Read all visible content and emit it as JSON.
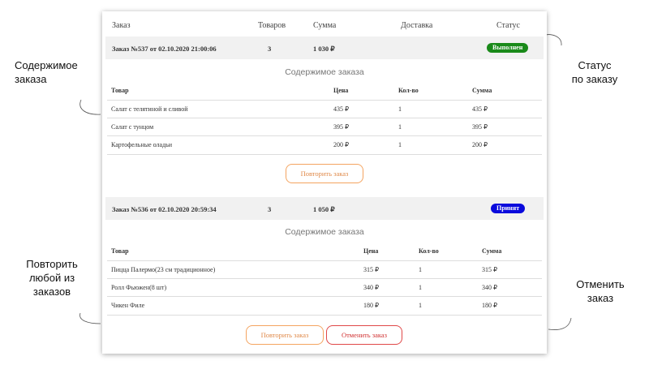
{
  "table_header": {
    "order": "Заказ",
    "items": "Товаров",
    "sum": "Сумма",
    "delivery": "Доставка",
    "status": "Статус"
  },
  "orders": [
    {
      "title": "Заказ №537 от 02.10.2020 21:00:06",
      "items_count": "3",
      "sum": "1 030 ₽",
      "status": "Выполнен",
      "status_color": "#1a8a1a",
      "contents_title": "Содержимое заказа",
      "columns": {
        "product": "Товар",
        "price": "Цена",
        "qty": "Кол-во",
        "sum": "Сумма"
      },
      "rows": [
        {
          "product": "Салат с телятиной и сливой",
          "price": "435 ₽",
          "qty": "1",
          "sum": "435 ₽"
        },
        {
          "product": "Салат с тунцом",
          "price": "395 ₽",
          "qty": "1",
          "sum": "395 ₽"
        },
        {
          "product": "Картофельные оладьи",
          "price": "200 ₽",
          "qty": "1",
          "sum": "200 ₽"
        }
      ],
      "repeat_label": "Повторить заказ"
    },
    {
      "title": "Заказ №536 от 02.10.2020 20:59:34",
      "items_count": "3",
      "sum": "1 050 ₽",
      "status": "Принят",
      "status_color": "#0a0adc",
      "contents_title": "Содержимое заказа",
      "columns": {
        "product": "Товар",
        "price": "Цена",
        "qty": "Кол-во",
        "sum": "Сумма"
      },
      "rows": [
        {
          "product": "Пицца Палермо(23 см традиционное)",
          "price": "315 ₽",
          "qty": "1",
          "sum": "315 ₽"
        },
        {
          "product": "Ролл Фьюжен(8 шт)",
          "price": "340 ₽",
          "qty": "1",
          "sum": "340 ₽"
        },
        {
          "product": "Чикен Филе",
          "price": "180 ₽",
          "qty": "1",
          "sum": "180 ₽"
        }
      ],
      "repeat_label": "Повторить заказ",
      "cancel_label": "Отменить заказ"
    }
  ],
  "annotations": {
    "contents": [
      "Содержимое",
      "заказа"
    ],
    "status": [
      "Статус",
      "по заказу"
    ],
    "repeat": [
      "Повторить",
      "любой из",
      "заказов"
    ],
    "cancel": [
      "Отменить",
      "заказ"
    ]
  }
}
